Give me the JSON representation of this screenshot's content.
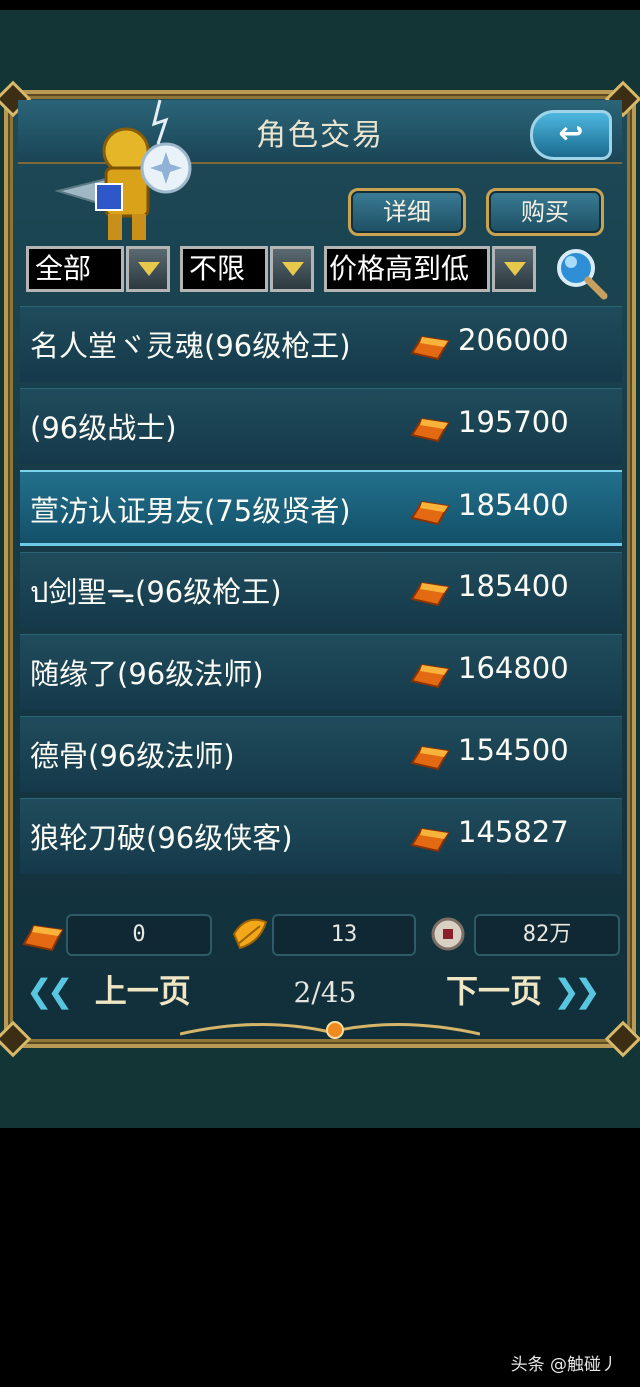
{
  "window": {
    "title": "角色交易",
    "back_icon": "back-arrow-icon"
  },
  "actions": {
    "detail_label": "详细",
    "buy_label": "购买"
  },
  "filters": {
    "category": "全部",
    "limit": "不限",
    "sort": "价格高到低"
  },
  "listings": [
    {
      "name": "名人堂ヾ灵魂(96级枪王)",
      "price": "206000",
      "selected": false
    },
    {
      "name": "(96级战士)",
      "price": "195700",
      "selected": false
    },
    {
      "name": "萱汸认证男友(75级贤者)",
      "price": "185400",
      "selected": true
    },
    {
      "name": "ป剑聖ᯓ(96级枪王)",
      "price": "185400",
      "selected": false
    },
    {
      "name": "随缘了(96级法师)",
      "price": "164800",
      "selected": false
    },
    {
      "name": "德骨(96级法师)",
      "price": "154500",
      "selected": false
    },
    {
      "name": "狼轮刀破(96级侠客)",
      "price": "145827",
      "selected": false
    }
  ],
  "currencies": [
    {
      "icon": "gold-ingot-icon",
      "value": "0"
    },
    {
      "icon": "gold-leaf-icon",
      "value": "13"
    },
    {
      "icon": "coin-icon",
      "value": "82万"
    }
  ],
  "pagination": {
    "prev_label": "上一页",
    "next_label": "下一页",
    "page": "2/45"
  },
  "watermark": "头条 @触碰丿",
  "colors": {
    "panel": "#173c48",
    "border_gold": "#b89a55",
    "selected_row": "#22708c",
    "accent_cyan": "#58c6e0"
  }
}
